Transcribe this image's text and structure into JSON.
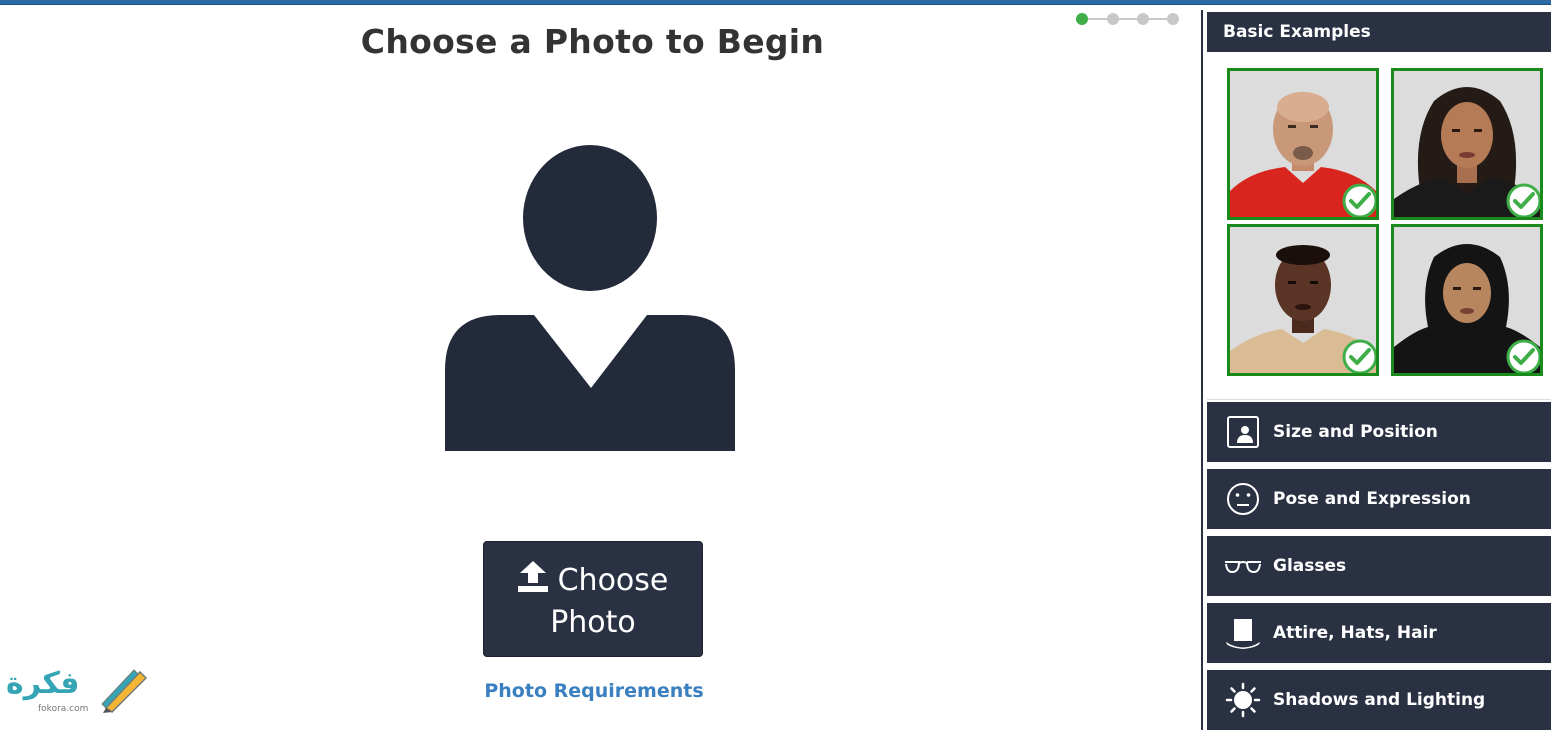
{
  "page": {
    "title": "Choose a Photo to Begin",
    "accent_color": "#3fae49",
    "dark_color": "#2a3142",
    "link_color": "#3a7fc0"
  },
  "progress": {
    "total_steps": 4,
    "current_step": 1
  },
  "upload": {
    "button_label_line1": "Choose",
    "button_label_line2": "Photo",
    "icon": "upload-icon",
    "requirements_link": "Photo Requirements"
  },
  "watermark": {
    "arabic_text": "فكرة",
    "latin_text": "fokora.com"
  },
  "sidebar": {
    "examples_heading": "Basic Examples",
    "examples": [
      {
        "name": "example-photo-1",
        "status": "check-icon"
      },
      {
        "name": "example-photo-2",
        "status": "check-icon"
      },
      {
        "name": "example-photo-3",
        "status": "check-icon"
      },
      {
        "name": "example-photo-4",
        "status": "check-icon"
      }
    ],
    "categories": [
      {
        "label": "Size and Position",
        "icon": "portrait-frame-icon"
      },
      {
        "label": "Pose and Expression",
        "icon": "neutral-face-icon"
      },
      {
        "label": "Glasses",
        "icon": "glasses-icon"
      },
      {
        "label": "Attire, Hats, Hair",
        "icon": "top-hat-icon"
      },
      {
        "label": "Shadows and Lighting",
        "icon": "sun-icon"
      }
    ]
  }
}
